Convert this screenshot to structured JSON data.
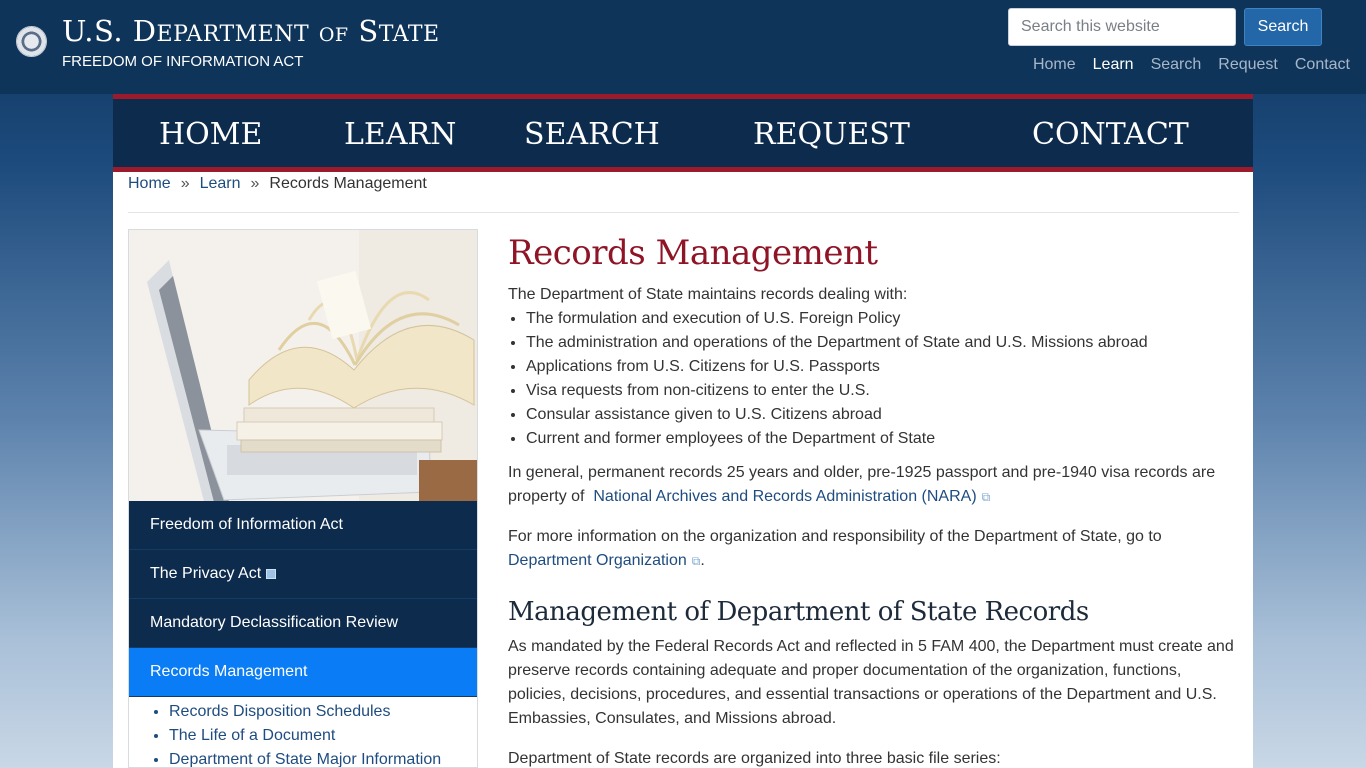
{
  "header": {
    "title_part1": "U.S. D",
    "title_part1b": "EPARTMENT",
    "title_of": "OF",
    "title_part2": "S",
    "title_part2b": "TATE",
    "subtitle": "FREEDOM OF INFORMATION ACT",
    "search_placeholder": "Search this website",
    "search_button": "Search",
    "utility_nav": [
      "Home",
      "Learn",
      "Search",
      "Request",
      "Contact"
    ]
  },
  "main_nav": [
    "HOME",
    "LEARN",
    "SEARCH",
    "REQUEST",
    "CONTACT"
  ],
  "breadcrumb": [
    "Home",
    "»",
    "Learn",
    "»",
    "Records Management"
  ],
  "sidebar": {
    "menu": [
      {
        "label": "Freedom of Information Act"
      },
      {
        "label": "The Privacy Act"
      },
      {
        "label": "Mandatory Declassification Review"
      },
      {
        "label": "Records Management"
      }
    ],
    "sublinks": [
      "Records Disposition Schedules",
      "The Life of a Document",
      "Department of State Major Information"
    ]
  },
  "article": {
    "title": "Records Management",
    "intro": "The Department of State maintains records dealing with:",
    "bullets": [
      "The formulation and execution of U.S. Foreign Policy",
      "The administration and operations of the Department of State and U.S. Missions abroad",
      "Applications from U.S. Citizens for U.S. Passports",
      "Visa requests from non-citizens to enter the U.S.",
      "Consular assistance given to U.S. Citizens abroad",
      "Current and former employees of the Department of State"
    ],
    "para1_text": "In general, permanent records 25 years and older, pre-1925 passport and pre-1940 visa records are property of",
    "para1_link": "National Archives and Records Administration (NARA)",
    "para2_text": "For more information on the organization and responsibility of the Department of State, go to",
    "para2_link": "Department Organization",
    "para2_end": ".",
    "heading2": "Management of Department of State Records",
    "para3": "As mandated by the Federal Records Act and reflected in 5 FAM 400, the Department must create and preserve records containing adequate and proper documentation of the organization, functions, policies, decisions, procedures, and essential transactions or operations of the Department and U.S. Embassies, Consulates, and Missions abroad.",
    "para4": "Department of State records are organized into three basic file series:"
  }
}
